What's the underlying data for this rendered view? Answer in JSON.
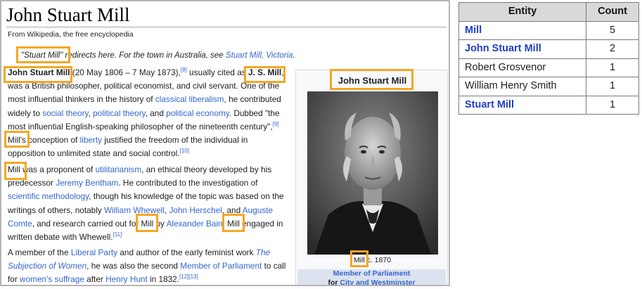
{
  "article": {
    "title": "John Stuart Mill",
    "tagline": "From Wikipedia, the free encyclopedia",
    "hatnote": {
      "quote": "\"Stuart Mill\"",
      "rest": " redirects here. For the town in Australia, see ",
      "link": "Stuart Mill, Victoria",
      "end": "."
    },
    "p1": {
      "name": "John Stuart Mill",
      "t1": " (20 May 1806 – 7 May 1873),",
      "ref1": "[8]",
      "t2": " usually cited as ",
      "js": "J. S. Mill",
      "t3": ", was a British philosopher, political economist, and civil servant. One of the most influential thinkers in the history of ",
      "l1": "classical liberalism",
      "t4": ", he contributed widely to ",
      "l2": "social theory",
      "t5": ", ",
      "l3": "political theory",
      "t6": ", and ",
      "l4": "political economy",
      "t7": ". Dubbed \"the most influential English-speaking philosopher of the nineteenth century\",",
      "ref2": "[9]",
      "t8": " Mill's conception of ",
      "l5": "liberty",
      "t9": " justified the freedom of the individual in opposition to unlimited state and social control.",
      "ref3": "[10]"
    },
    "p2": {
      "t1": "Mill was a proponent of ",
      "l1": "utilitarianism",
      "t2": ", an ethical theory developed by his predecessor ",
      "l2": "Jeremy Bentham",
      "t3": ". He contributed to the investigation of ",
      "l3": "scientific methodology",
      "t4": ", though his knowledge of the topic was based on the writings of others, notably ",
      "l4": "William Whewell",
      "t5": ", ",
      "l5": "John Herschel",
      "t6": ", and ",
      "l6": "Auguste Comte",
      "t7": ", and research carried out for Mill by ",
      "l7": "Alexander Bain",
      "t8": ". Mill engaged in written debate with Whewell.",
      "ref1": "[11]"
    },
    "p3": {
      "t1": "A member of the ",
      "l1": "Liberal Party",
      "t2": " and author of the early feminist work ",
      "l2": "The Subjection of Women",
      "t3": ", he was also the second ",
      "l3": "Member of Parliament",
      "t4": " to call for ",
      "l4": "women's suffrage",
      "t5": " after ",
      "l5": "Henry Hunt",
      "t6": " in 1832.",
      "ref1": "[12][13]"
    },
    "infobox": {
      "title": "John Stuart Mill",
      "caption": "Mill c. 1870",
      "band_line1": "Member of Parliament",
      "band_for": "for ",
      "band_link": "City and Westminster"
    }
  },
  "entity_table": {
    "headers": [
      "Entity",
      "Count"
    ],
    "rows": [
      {
        "entity": "Mill",
        "count": "5",
        "linked": true
      },
      {
        "entity": "John Stuart Mill",
        "count": "2",
        "linked": true
      },
      {
        "entity": "Robert Grosvenor",
        "count": "1",
        "linked": false
      },
      {
        "entity": "William Henry Smith",
        "count": "1",
        "linked": false
      },
      {
        "entity": "Stuart Mill",
        "count": "1",
        "linked": true
      }
    ]
  },
  "colors": {
    "highlight": "#f5a623",
    "link": "#3366cc",
    "entity_link": "#1f3ec9",
    "table_header_bg": "#d9d9d9"
  }
}
